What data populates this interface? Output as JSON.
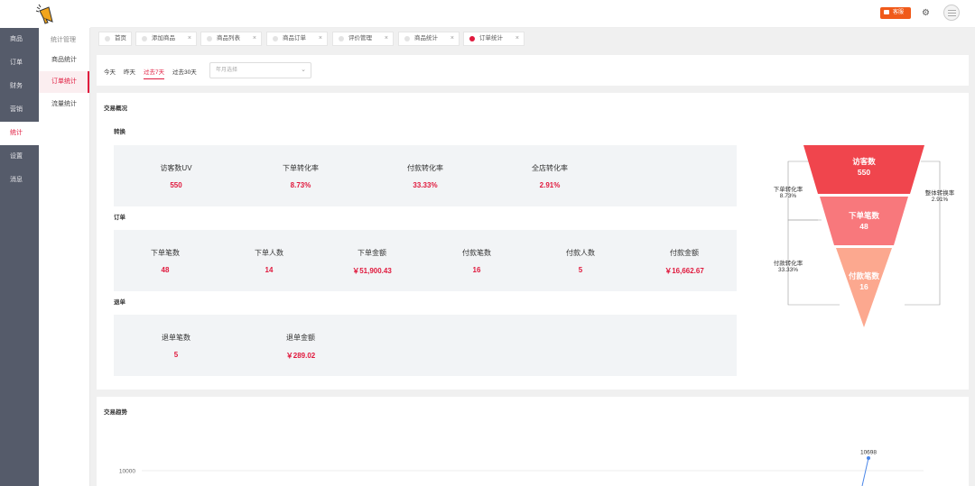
{
  "nav": {
    "items": [
      {
        "label": "商品"
      },
      {
        "label": "订单"
      },
      {
        "label": "财务"
      },
      {
        "label": "营销"
      },
      {
        "label": "统计"
      },
      {
        "label": "设置"
      },
      {
        "label": "消息"
      }
    ],
    "active_index": 4
  },
  "submenu": {
    "title": "统计管理",
    "items": [
      {
        "label": "商品统计"
      },
      {
        "label": "订单统计"
      },
      {
        "label": "流量统计"
      }
    ],
    "active_index": 1
  },
  "header": {
    "kefu_label": "客服"
  },
  "tabs": [
    {
      "label": "首页",
      "closable": false
    },
    {
      "label": "添加商品",
      "closable": true
    },
    {
      "label": "商品列表",
      "closable": true
    },
    {
      "label": "商品订单",
      "closable": true
    },
    {
      "label": "评价管理",
      "closable": true
    },
    {
      "label": "商品统计",
      "closable": true
    },
    {
      "label": "订单统计",
      "closable": true,
      "active": true
    }
  ],
  "filter": {
    "options": [
      "今天",
      "昨天",
      "过去7天",
      "过去30天"
    ],
    "active_index": 2,
    "month_placeholder": "年月选择"
  },
  "overview": {
    "title": "交易概况",
    "conversion": {
      "label": "转换",
      "stats": [
        {
          "label": "访客数UV",
          "value": "550"
        },
        {
          "label": "下单转化率",
          "value": "8.73%"
        },
        {
          "label": "付款转化率",
          "value": "33.33%"
        },
        {
          "label": "全店转化率",
          "value": "2.91%"
        }
      ]
    },
    "orders": {
      "label": "订单",
      "stats": [
        {
          "label": "下单笔数",
          "value": "48"
        },
        {
          "label": "下单人数",
          "value": "14"
        },
        {
          "label": "下单金额",
          "value": "￥51,900.43"
        },
        {
          "label": "付款笔数",
          "value": "16"
        },
        {
          "label": "付款人数",
          "value": "5"
        },
        {
          "label": "付款金额",
          "value": "￥16,662.67"
        }
      ]
    },
    "refunds": {
      "label": "退单",
      "stats": [
        {
          "label": "退单笔数",
          "value": "5"
        },
        {
          "label": "退单金额",
          "value": "￥289.02"
        }
      ]
    },
    "funnel": {
      "stages": [
        {
          "name": "访客数",
          "value": "550",
          "color": "#f0454d"
        },
        {
          "name": "下单笔数",
          "value": "48",
          "color": "#f8787c"
        },
        {
          "name": "付款笔数",
          "value": "16",
          "color": "#fca88f"
        }
      ],
      "rates": [
        {
          "label": "下单转化率",
          "value": "8.73%"
        },
        {
          "label": "付款转化率",
          "value": "33.33%"
        },
        {
          "label": "整体转换率",
          "value": "2.91%"
        }
      ]
    }
  },
  "trend": {
    "title": "交易趋势",
    "chart_data": {
      "type": "line",
      "y_tick_labels": [
        "10000"
      ],
      "data_labels": [
        "10698"
      ],
      "series": [
        {
          "values": [
            10698
          ]
        }
      ]
    }
  },
  "colors": {
    "accent": "#e0193d",
    "nav_bg": "#555b6a",
    "kefu_btn": "#f05a1a"
  }
}
